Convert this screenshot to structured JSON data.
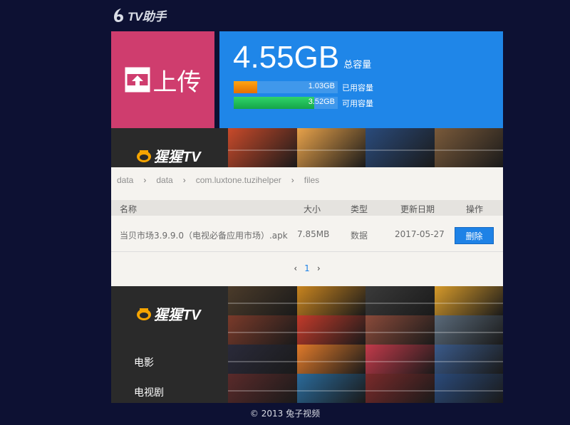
{
  "app": {
    "logo_text": "TV助手"
  },
  "upload": {
    "label": "上传"
  },
  "storage": {
    "total_value": "4.55GB",
    "total_label": "总容量",
    "used": {
      "value": "1.03GB",
      "label": "已用容量",
      "fraction": 0.226
    },
    "free": {
      "value": "3.52GB",
      "label": "可用容量",
      "fraction": 0.774
    }
  },
  "brand": {
    "name": "猩猩TV"
  },
  "breadcrumb": [
    "data",
    "data",
    "com.luxtone.tuzihelper",
    "files"
  ],
  "table": {
    "headers": {
      "name": "名称",
      "size": "大小",
      "type": "类型",
      "date": "更新日期",
      "action": "操作"
    },
    "rows": [
      {
        "name": "当贝市场3.9.9.0（电视必备应用市场）.apk",
        "size": "7.85MB",
        "type": "数据",
        "date": "2017-05-27",
        "action": "删除"
      }
    ]
  },
  "pagination": {
    "prev": "‹",
    "current": "1",
    "next": "›"
  },
  "nav": {
    "items": [
      "电影",
      "电视剧"
    ]
  },
  "footer": {
    "copyright": "© 2013 兔子视频"
  },
  "colors": {
    "upload_bg": "#cf3d6e",
    "storage_bg": "#1f86e8",
    "page_bg": "#0d1133",
    "accent": "#1e82e6"
  },
  "posters": {
    "top_colors": [
      "#c94a2a",
      "#e8a24a",
      "#2a4b7c",
      "#7a5a3a"
    ],
    "bottom_colors": [
      "#4b3b2a",
      "#c8841f",
      "#3a3a3a",
      "#d69a2a",
      "#7a3a2a",
      "#c23a2a",
      "#8a4a3a",
      "#5a6a7a",
      "#2a2a3a",
      "#e07a2a",
      "#c23a4a",
      "#3a5a8a",
      "#5a2a2a",
      "#2a6a9a",
      "#7a2a2a",
      "#2a4a7a"
    ]
  }
}
